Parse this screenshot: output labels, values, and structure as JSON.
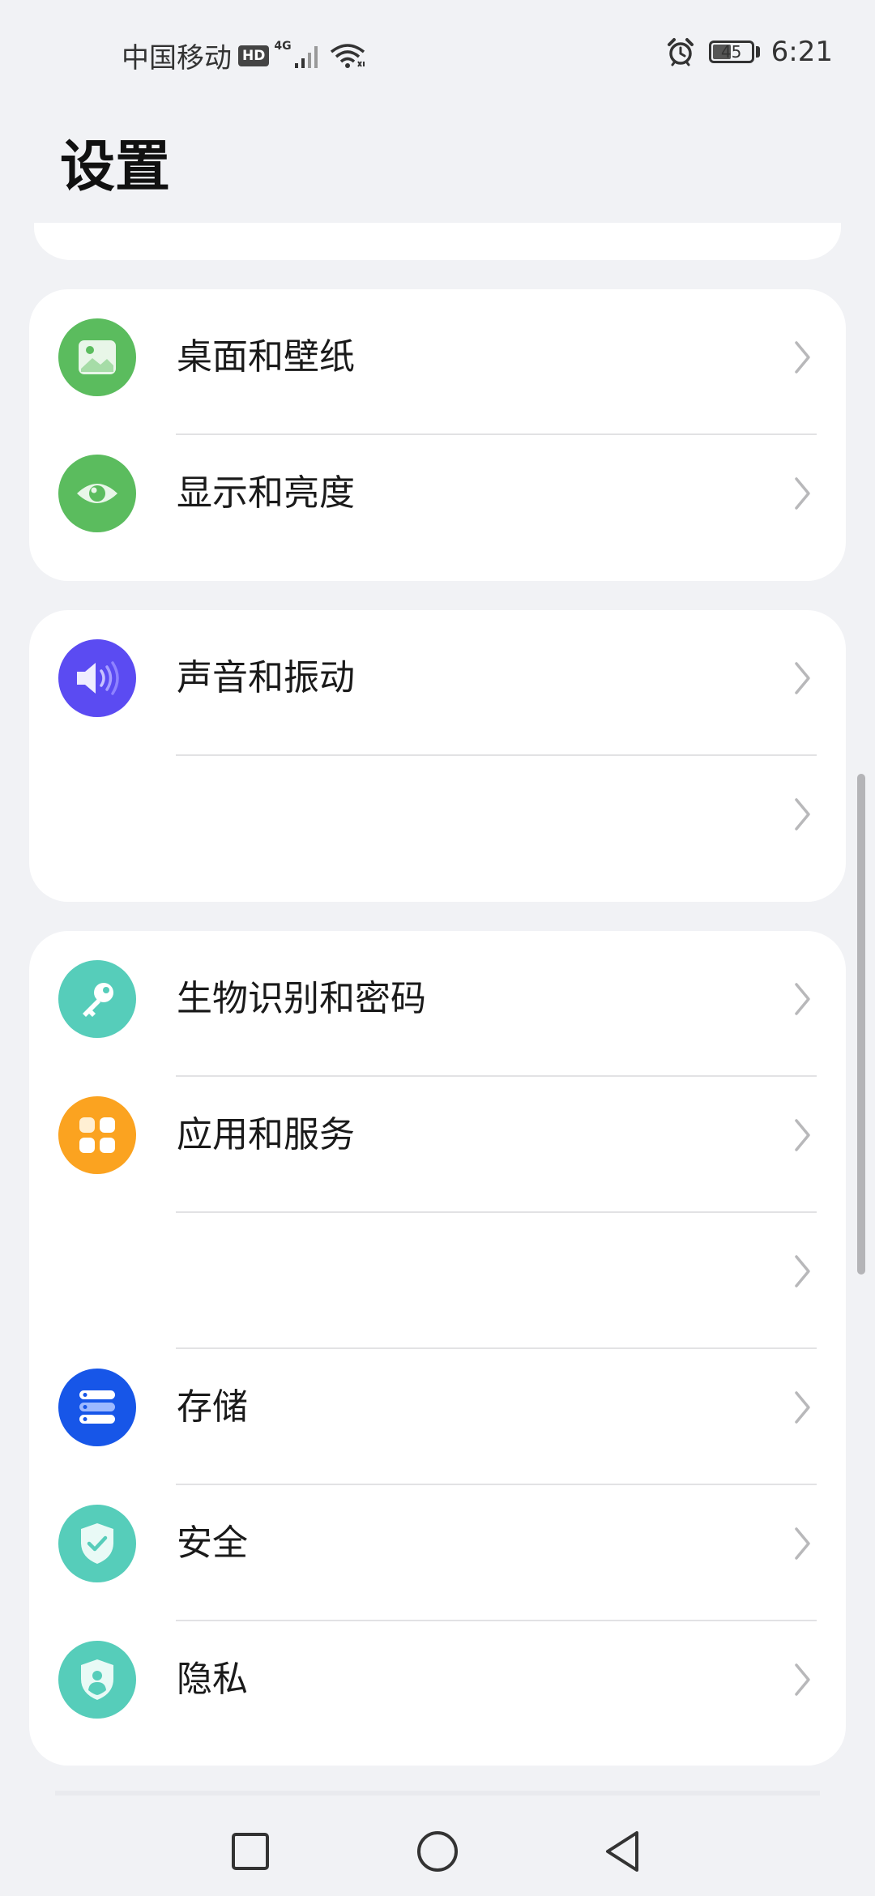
{
  "status_bar": {
    "carrier": "中国移动",
    "hd_badge": "HD",
    "network_type": "4G",
    "battery_level": "45",
    "time": "6:21",
    "icons": [
      "signal-icon",
      "wifi-icon",
      "alarm-icon",
      "battery-icon"
    ]
  },
  "page": {
    "title": "设置"
  },
  "groups": [
    {
      "items": [
        {
          "label": "桌面和壁纸",
          "icon": "wallpaper-icon",
          "color": "#5BBC5E"
        },
        {
          "label": "显示和亮度",
          "icon": "eye-icon",
          "color": "#5BBC5E"
        }
      ]
    },
    {
      "items": [
        {
          "label": "声音和振动",
          "icon": "speaker-icon",
          "color": "#5B4BF2"
        },
        {
          "label": "",
          "icon": "",
          "color": ""
        }
      ]
    },
    {
      "items": [
        {
          "label": "生物识别和密码",
          "icon": "key-icon",
          "color": "#56CDBA"
        },
        {
          "label": "应用和服务",
          "icon": "apps-grid-icon",
          "color": "#FBA320"
        },
        {
          "label": "",
          "icon": "",
          "color": ""
        },
        {
          "label": "存储",
          "icon": "storage-icon",
          "color": "#1756E8"
        },
        {
          "label": "安全",
          "icon": "shield-check-icon",
          "color": "#56CDBA"
        },
        {
          "label": "隐私",
          "icon": "privacy-shield-icon",
          "color": "#56CDBA"
        }
      ]
    }
  ],
  "nav_bar": {
    "buttons": [
      "recent-apps-button",
      "home-button",
      "back-button"
    ]
  }
}
